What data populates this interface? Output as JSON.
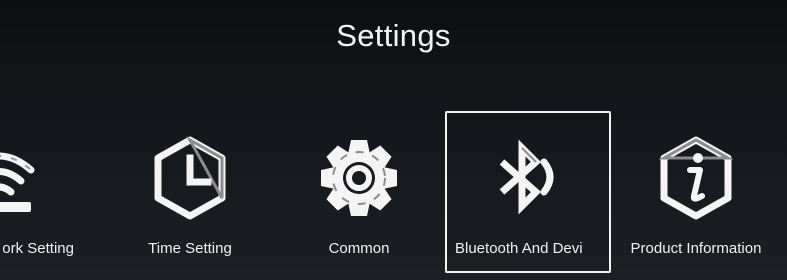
{
  "header": {
    "title": "Settings"
  },
  "tiles": [
    {
      "label": "ork Setting",
      "icon": "wifi-icon"
    },
    {
      "label": "Time Setting",
      "icon": "clock-icon"
    },
    {
      "label": "Common",
      "icon": "gear-icon"
    },
    {
      "label": "Bluetooth And Devi",
      "icon": "bluetooth-icon",
      "focused": true
    },
    {
      "label": "Product Information",
      "icon": "info-icon"
    }
  ],
  "colors": {
    "background": "#16191d",
    "focus_border": "#f2f2f2",
    "text": "#f2f2f2",
    "icon_fill": "#f4f4f4",
    "icon_shade": "#9a9a9a"
  }
}
